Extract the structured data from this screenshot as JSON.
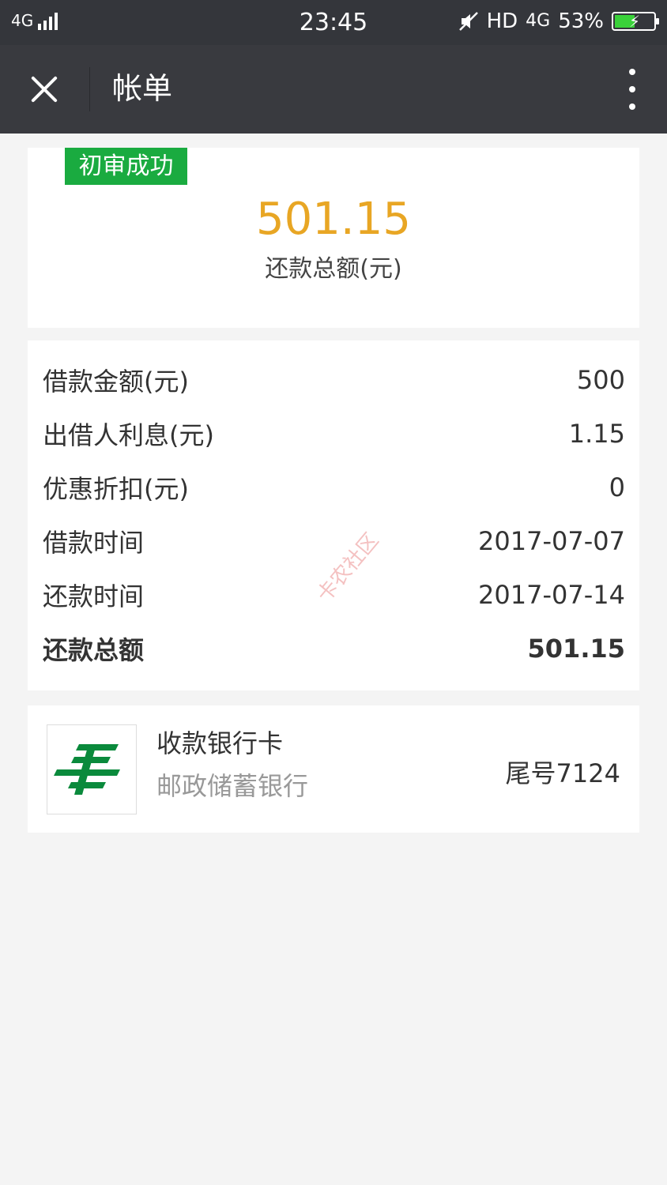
{
  "status_bar": {
    "network": "4G",
    "time": "23:45",
    "hd": "HD",
    "network_gen": "4G",
    "battery": "53%",
    "battery_level": 0.53
  },
  "nav": {
    "title": "帐单"
  },
  "summary": {
    "badge": "初审成功",
    "amount": "501.15",
    "amount_label": "还款总额(元)"
  },
  "details": {
    "rows": [
      {
        "label": "借款金额(元)",
        "value": "500"
      },
      {
        "label": "出借人利息(元)",
        "value": "1.15"
      },
      {
        "label": "优惠折扣(元)",
        "value": "0"
      },
      {
        "label": "借款时间",
        "value": "2017-07-07"
      },
      {
        "label": "还款时间",
        "value": "2017-07-14"
      },
      {
        "label": "还款总额",
        "value": "501.15"
      }
    ],
    "watermark": "卡农社区"
  },
  "bank": {
    "title": "收款银行卡",
    "name": "邮政储蓄银行",
    "tail": "尾号7124",
    "logo_color": "#0a8a3c"
  },
  "colors": {
    "badge_green": "#1aab40",
    "amount_orange": "#e8a624",
    "header_dark": "#393a3f"
  }
}
